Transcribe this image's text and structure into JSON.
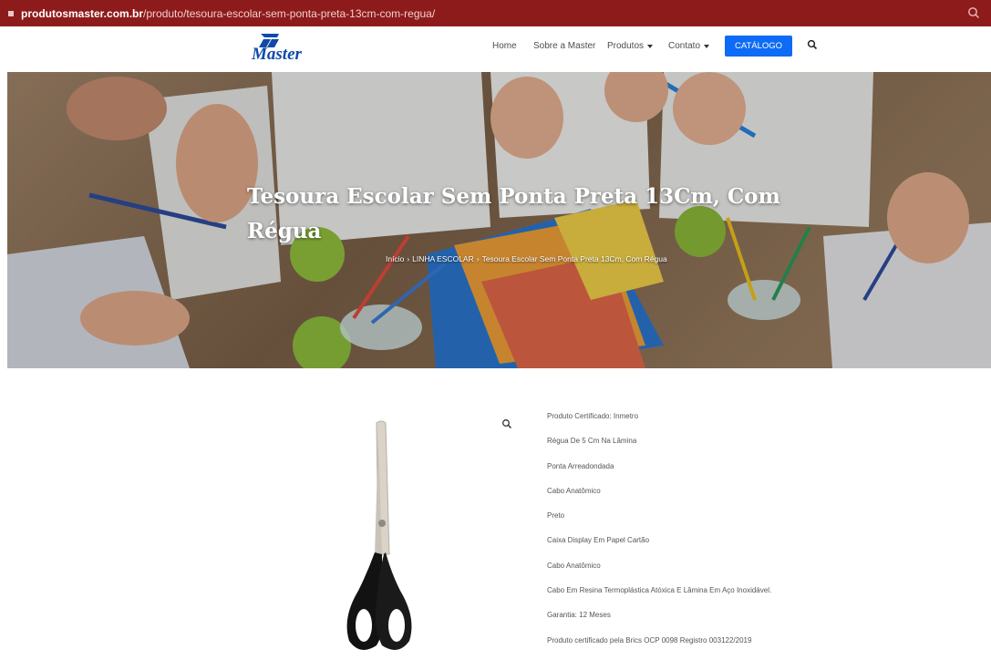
{
  "browser": {
    "url_host": "produtosmaster.com.br",
    "url_path": "/produto/tesoura-escolar-sem-ponta-preta-13cm-com-regua/",
    "search_icon": "search-icon"
  },
  "header": {
    "logo_text": "Master",
    "nav": [
      "Home",
      "Sobre a Master",
      "Produtos",
      "Contato"
    ],
    "catalog_label": "CATÁLOGO",
    "accent_color": "#0d6bf5"
  },
  "hero": {
    "title": "Tesoura Escolar Sem Ponta Preta 13Cm, Com Régua",
    "breadcrumb": [
      "Início",
      "LINHA ESCOLAR",
      "Tesoura Escolar Sem Ponta Preta 13Cm, Com Régua"
    ],
    "breadcrumb_sep": "›"
  },
  "product": {
    "zoom_icon": "zoom-icon",
    "specs": [
      "Produto Certificado: Inmetro",
      "Régua De 5 Cm Na Lâmina",
      "Ponta Arreadondada",
      "Cabo Anatômico",
      "Preto",
      "Caixa Display Em Papel Cartão",
      "Cabo Anatômico",
      "Cabo Em Resina Termoplástica Atóxica E Lâmina Em Aço Inoxidável.",
      "Garantia: 12 Meses",
      "Produto certificado pela Brics OCP 0098 Registro 003122/2019"
    ]
  },
  "colors": {
    "urlbar": "#8e1b1b",
    "brand_blue": "#0f4aa8"
  }
}
